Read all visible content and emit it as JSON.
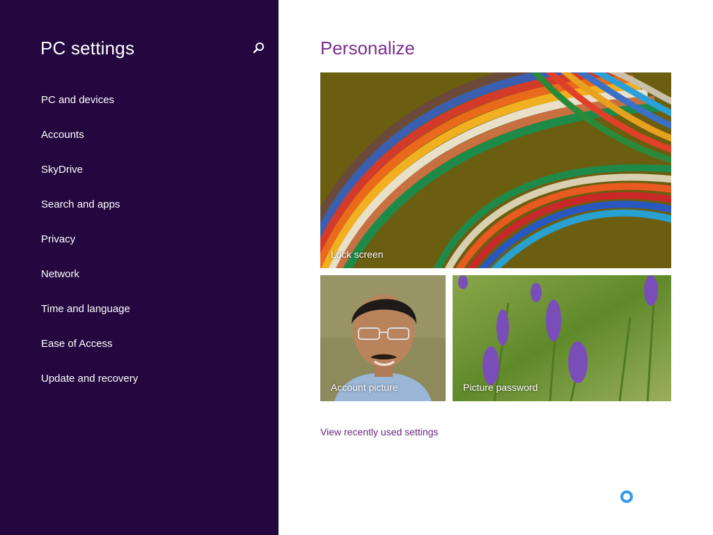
{
  "sidebar": {
    "title": "PC settings",
    "search_icon": "search-icon",
    "items": [
      {
        "label": "PC and devices"
      },
      {
        "label": "Accounts"
      },
      {
        "label": "SkyDrive"
      },
      {
        "label": "Search and apps"
      },
      {
        "label": "Privacy"
      },
      {
        "label": "Network"
      },
      {
        "label": "Time and language"
      },
      {
        "label": "Ease of Access"
      },
      {
        "label": "Update and recovery"
      }
    ]
  },
  "main": {
    "title": "Personalize",
    "tiles": {
      "lock_screen": {
        "label": "Lock screen"
      },
      "account_picture": {
        "label": "Account picture"
      },
      "picture_password": {
        "label": "Picture password"
      }
    },
    "recent_link": "View recently used settings"
  },
  "colors": {
    "sidebar_bg": "#24073f",
    "accent": "#7a2e8e",
    "spinner": "#3399ee"
  }
}
